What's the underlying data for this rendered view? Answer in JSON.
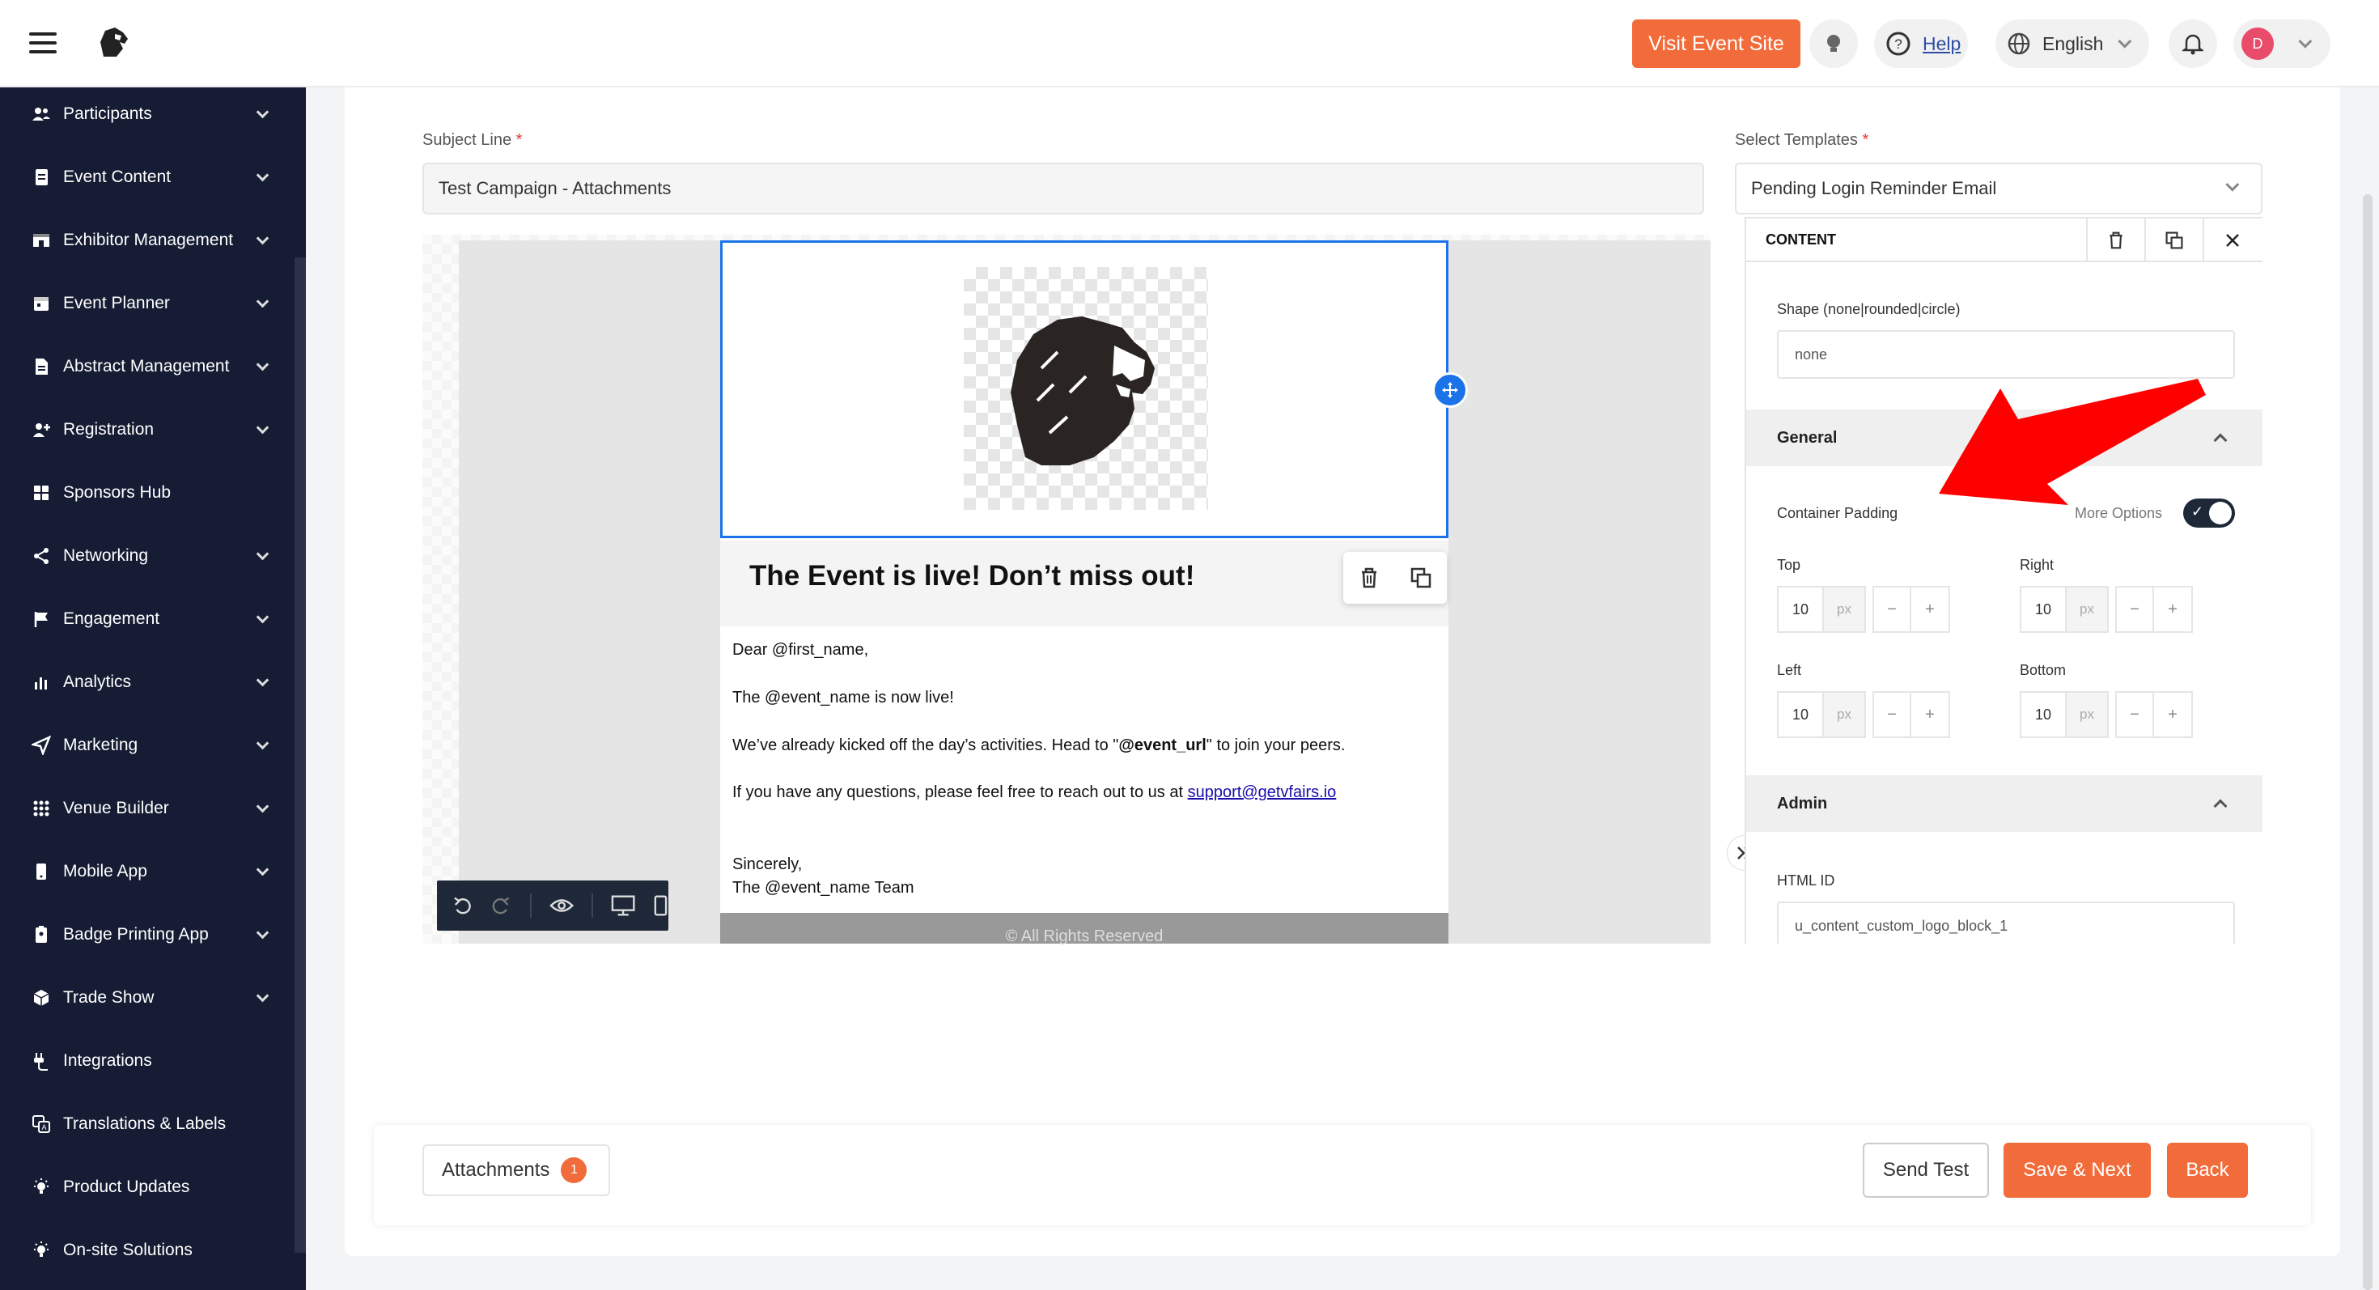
{
  "topbar": {
    "visit_label": "Visit Event Site",
    "help_label": "Help",
    "language": "English",
    "avatar_initial": "D"
  },
  "sidebar": {
    "items": [
      {
        "label": "Participants",
        "icon": "users-icon",
        "has_caret": true
      },
      {
        "label": "Event Content",
        "icon": "document-icon",
        "has_caret": true
      },
      {
        "label": "Exhibitor Management",
        "icon": "booth-icon",
        "has_caret": true
      },
      {
        "label": "Event Planner",
        "icon": "calendar-icon",
        "has_caret": true
      },
      {
        "label": "Abstract Management",
        "icon": "file-icon",
        "has_caret": true
      },
      {
        "label": "Registration",
        "icon": "user-plus-icon",
        "has_caret": true
      },
      {
        "label": "Sponsors Hub",
        "icon": "grid-icon",
        "has_caret": false
      },
      {
        "label": "Networking",
        "icon": "share-icon",
        "has_caret": true
      },
      {
        "label": "Engagement",
        "icon": "flag-icon",
        "has_caret": true
      },
      {
        "label": "Analytics",
        "icon": "bar-chart-icon",
        "has_caret": true
      },
      {
        "label": "Marketing",
        "icon": "send-icon",
        "has_caret": true
      },
      {
        "label": "Venue Builder",
        "icon": "apps-icon",
        "has_caret": true
      },
      {
        "label": "Mobile App",
        "icon": "mobile-icon",
        "has_caret": true
      },
      {
        "label": "Badge Printing App",
        "icon": "badge-icon",
        "has_caret": true
      },
      {
        "label": "Trade Show",
        "icon": "box-icon",
        "has_caret": true
      },
      {
        "label": "Integrations",
        "icon": "plug-icon",
        "has_caret": false
      },
      {
        "label": "Translations & Labels",
        "icon": "translate-icon",
        "has_caret": false
      },
      {
        "label": "Product Updates",
        "icon": "bulb-icon",
        "has_caret": false
      },
      {
        "label": "On-site Solutions",
        "icon": "bulb-icon",
        "has_caret": false
      }
    ]
  },
  "form": {
    "subject_label": "Subject Line",
    "subject_value": "Test Campaign - Attachments",
    "template_label": "Select Templates",
    "template_value": "Pending Login Reminder Email",
    "required_mark": "*"
  },
  "email": {
    "headline": "The Event is live! Don’t miss out!",
    "greeting": "Dear @first_name,",
    "line1": "The @event_name is now live!",
    "line2_pre": "We’ve already kicked off the day’s activities. Head to \"",
    "line2_bold": "@event_url",
    "line2_post": "\" to join your peers.",
    "line3_pre": "If you have any questions, please feel free to reach out to us at ",
    "line3_link": "support@getvfairs.io",
    "signoff": "Sincerely,",
    "team": "The @event_name Team",
    "footer": "© All Rights Reserved"
  },
  "panel": {
    "title": "CONTENT",
    "shape_label": "Shape (none|rounded|circle)",
    "shape_value": "none",
    "general_label": "General",
    "container_padding_label": "Container Padding",
    "more_options_label": "More Options",
    "more_options_on": true,
    "top_label": "Top",
    "right_label": "Right",
    "left_label": "Left",
    "bottom_label": "Bottom",
    "top_value": "10",
    "right_value": "10",
    "left_value": "10",
    "bottom_value": "10",
    "unit": "px",
    "minus": "−",
    "plus": "+",
    "admin_label": "Admin",
    "html_id_label": "HTML ID",
    "html_id_value": "u_content_custom_logo_block_1"
  },
  "actions": {
    "attachments_label": "Attachments",
    "attachments_count": "1",
    "send_test_label": "Send Test",
    "save_next_label": "Save & Next",
    "back_label": "Back"
  },
  "colors": {
    "accent": "#f26b3a",
    "sidebar_bg": "#151c33",
    "selection": "#1a73e8",
    "annotation_arrow": "#ff0000"
  }
}
